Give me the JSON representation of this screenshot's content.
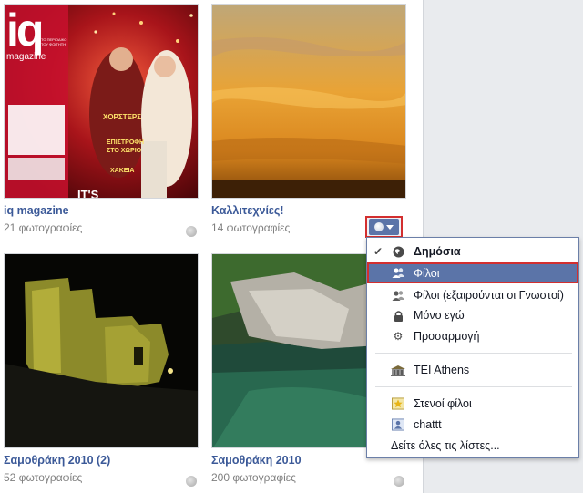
{
  "albums": [
    {
      "title": "iq magazine",
      "count": "21 φωτογραφίες"
    },
    {
      "title": "Καλλιτεχνίες!",
      "count": "14 φωτογραφίες"
    },
    {
      "title": "Σαμοθράκη 2010 (2)",
      "count": "52 φωτογραφίες"
    },
    {
      "title": "Σαμοθράκη 2010",
      "count": "200 φωτογραφίες"
    }
  ],
  "cover": {
    "logo": "iq",
    "logo_sub": "magazine",
    "logo_tag": "ΤΟ ΠΕΡΙΟΔΙΚΟ ΤΟΥ ΦΟΙΤΗΤΗ",
    "headline1": "ΧΟΡΣΤΕΡΣ",
    "headline2": "ΕΠΙΣΤΡΟΦΗ ΣΤΟ ΧΩΡΙΟ",
    "headline3": "ΧΑΚΕΙΑ",
    "its": "IT'S"
  },
  "privacy_menu": {
    "items": [
      {
        "label": "Δημόσια",
        "icon": "globe-icon"
      },
      {
        "label": "Φίλοι",
        "icon": "friends-icon"
      },
      {
        "label": "Φίλοι (εξαιρούνται οι Γνωστοί)",
        "icon": "friends-except-icon"
      },
      {
        "label": "Μόνο εγώ",
        "icon": "lock-icon"
      },
      {
        "label": "Προσαρμογή",
        "icon": "gear-icon"
      },
      {
        "label": "TEI Athens",
        "icon": "school-icon"
      },
      {
        "label": "Στενοί φίλοι",
        "icon": "star-icon"
      },
      {
        "label": "chattt",
        "icon": "list-icon"
      }
    ],
    "see_all": "Δείτε όλες τις λίστες..."
  },
  "colors": {
    "link": "#3b5998",
    "selected": "#5b74a8",
    "highlight_border": "#d32f2f"
  }
}
